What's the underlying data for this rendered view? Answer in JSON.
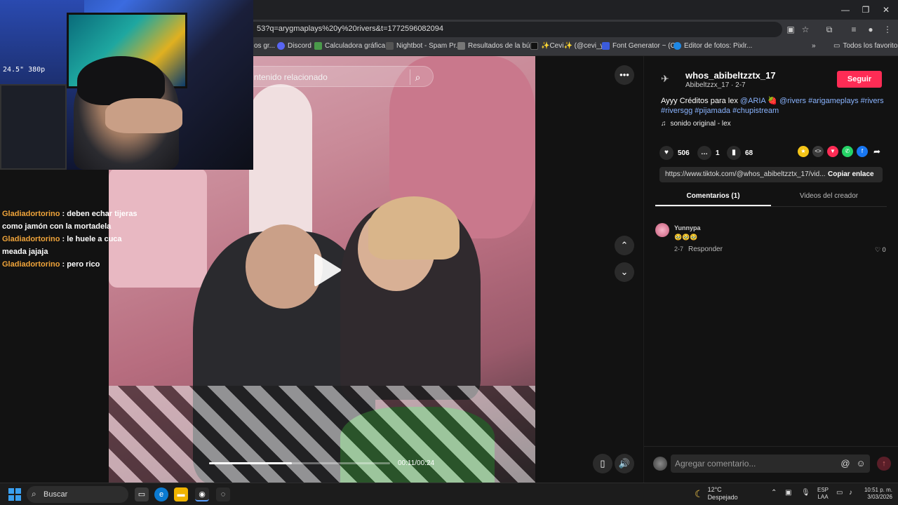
{
  "browser": {
    "url": "53?q=arygmaplays%20y%20rivers&t=1772596082094",
    "bookmarks": [
      {
        "label": "os gr...",
        "color": "#888888"
      },
      {
        "label": "Discord",
        "color": "#5865f2"
      },
      {
        "label": "Calculadora gráfica...",
        "color": "#4a9a4a"
      },
      {
        "label": "Nightbot - Spam Pr...",
        "color": "#555555"
      },
      {
        "label": "Resultados de la bú...",
        "color": "#777777"
      },
      {
        "label": "✨Cevi✨ (@cevi_y...",
        "color": "#111111"
      },
      {
        "label": "Font Generator ~ (C...",
        "color": "#3b5bdb"
      },
      {
        "label": "Editor de fotos: Pixlr...",
        "color": "#1e88e5"
      }
    ],
    "all_bookmarks": "Todos los favoritos",
    "window_controls": {
      "minimize": "—",
      "restore": "❐",
      "close": "✕"
    }
  },
  "webcam": {
    "overlay_text": "24.5\" 380p"
  },
  "chat": [
    {
      "user": "Gladiadortorino",
      "message": "deben echar tijeras como jamón con la mortadela"
    },
    {
      "user": "Gladiadortorino",
      "message": "le huele a cuca meada jajaja"
    },
    {
      "user": "Gladiadortorino",
      "message": "pero rico"
    }
  ],
  "video": {
    "search_placeholder": "ntenido relacionado",
    "time": "00:11/00:24",
    "progress": 0.4583
  },
  "post": {
    "author": "whos_abibeltzztx_17",
    "author_sub": "Abibeltzzx_17 · 2-7",
    "follow_label": "Seguir",
    "caption_lead": "Ayyy Créditos para lex ",
    "caption_mention1": "@ARIA",
    "caption_mid": " 🍓 ",
    "caption_mention2": "@rivers",
    "caption_tags": " #arigameplays #rivers #riversgg #pijamada #chupistream",
    "sound": "sonido original - lex",
    "likes": "506",
    "comments": "1",
    "saves": "68",
    "link": "https://www.tiktok.com/@whos_abibeltzztx_17/vid...",
    "copy_label": "Copiar enlace",
    "tabs": [
      "Comentarios (1)",
      "Videos del creador"
    ]
  },
  "comment": {
    "user": "Yunnypa",
    "text": "🥹🥹🥹",
    "date": "2-7",
    "reply_label": "Responder",
    "likes": "0"
  },
  "comment_input": {
    "placeholder": "Agregar comentario..."
  },
  "taskbar": {
    "search_label": "Buscar",
    "temp": "12°C",
    "condition": "Despejado",
    "lang1": "ESP",
    "lang2": "LAA",
    "time": "10:51 p. m.",
    "date": "3/03/2026"
  },
  "colors": {
    "accent": "#fe2c55",
    "chat_user": "#f0a43a",
    "hashtag": "#8ab4ff"
  }
}
